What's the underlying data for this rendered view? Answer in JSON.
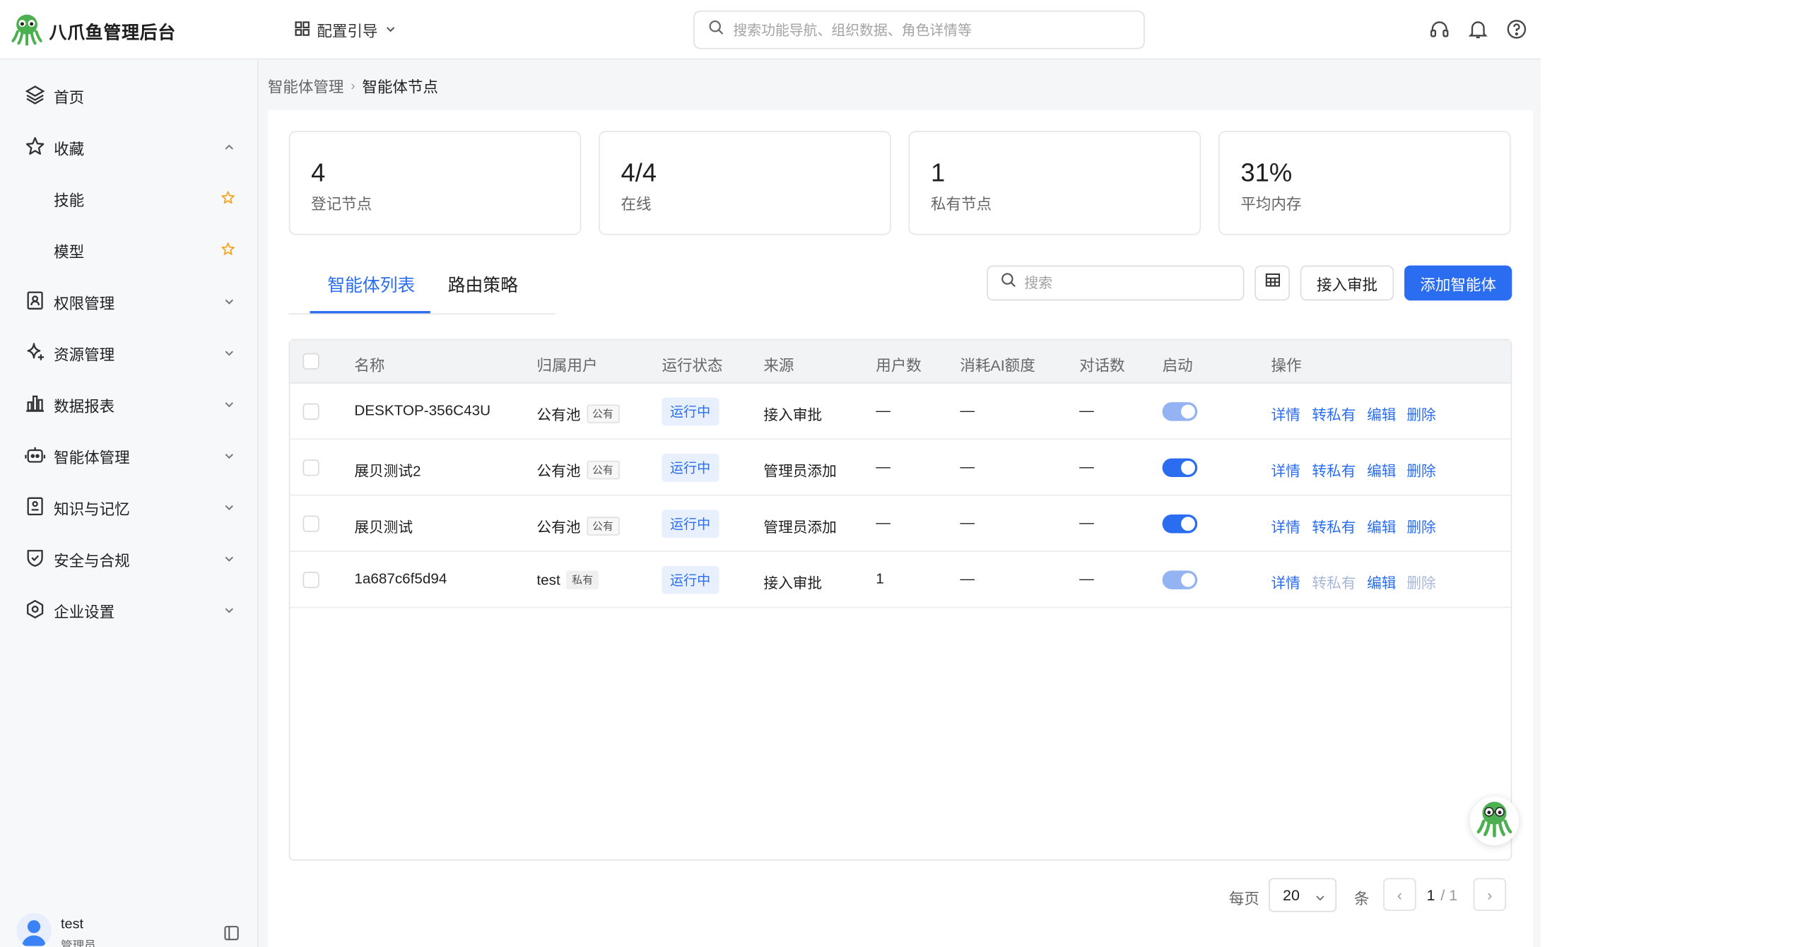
{
  "app": {
    "title": "八爪鱼管理后台"
  },
  "header": {
    "config_guide": "配置引导",
    "search_placeholder": "搜索功能导航、组织数据、角色详情等"
  },
  "sidebar": {
    "items": [
      {
        "label": "首页",
        "icon": "layers-icon"
      },
      {
        "label": "收藏",
        "icon": "star-outline-icon",
        "expanded": true
      },
      {
        "label": "技能",
        "icon": "star-filled-icon",
        "child": true
      },
      {
        "label": "模型",
        "icon": "star-filled-icon",
        "child": true
      },
      {
        "label": "权限管理",
        "icon": "id-card-icon"
      },
      {
        "label": "资源管理",
        "icon": "sparkle-icon"
      },
      {
        "label": "数据报表",
        "icon": "bar-chart-icon"
      },
      {
        "label": "智能体管理",
        "icon": "robot-icon"
      },
      {
        "label": "知识与记忆",
        "icon": "book-icon"
      },
      {
        "label": "安全与合规",
        "icon": "shield-check-icon"
      },
      {
        "label": "企业设置",
        "icon": "settings-hex-icon"
      }
    ],
    "user": {
      "name": "test",
      "role": "管理员"
    }
  },
  "breadcrumb": {
    "parent": "智能体管理",
    "current": "智能体节点"
  },
  "stats": [
    {
      "value": "4",
      "label": "登记节点"
    },
    {
      "value": "4/4",
      "label": "在线"
    },
    {
      "value": "1",
      "label": "私有节点"
    },
    {
      "value": "31%",
      "label": "平均内存"
    }
  ],
  "tabs": [
    {
      "label": "智能体列表",
      "active": true
    },
    {
      "label": "路由策略",
      "active": false
    }
  ],
  "toolbar": {
    "search_placeholder": "搜索",
    "approve_label": "接入审批",
    "add_label": "添加智能体"
  },
  "table": {
    "columns": [
      "名称",
      "归属用户",
      "运行状态",
      "来源",
      "用户数",
      "消耗AI额度",
      "对话数",
      "启动",
      "操作"
    ],
    "rows": [
      {
        "name": "DESKTOP-356C43U",
        "owner": "公有池",
        "owner_tag": "公有",
        "status": "运行中",
        "source": "接入审批",
        "users": "—",
        "quota": "—",
        "chats": "—",
        "enabled": true,
        "toggle_dim": true,
        "actions": [
          "详情",
          "转私有",
          "编辑",
          "删除"
        ],
        "actions_disabled": [
          false,
          false,
          false,
          false
        ]
      },
      {
        "name": "展贝测试2",
        "owner": "公有池",
        "owner_tag": "公有",
        "status": "运行中",
        "source": "管理员添加",
        "users": "—",
        "quota": "—",
        "chats": "—",
        "enabled": true,
        "toggle_dim": false,
        "actions": [
          "详情",
          "转私有",
          "编辑",
          "删除"
        ],
        "actions_disabled": [
          false,
          false,
          false,
          false
        ]
      },
      {
        "name": "展贝测试",
        "owner": "公有池",
        "owner_tag": "公有",
        "status": "运行中",
        "source": "管理员添加",
        "users": "—",
        "quota": "—",
        "chats": "—",
        "enabled": true,
        "toggle_dim": false,
        "actions": [
          "详情",
          "转私有",
          "编辑",
          "删除"
        ],
        "actions_disabled": [
          false,
          false,
          false,
          false
        ]
      },
      {
        "name": "1a687c6f5d94",
        "owner": "test",
        "owner_tag": "私有",
        "status": "运行中",
        "source": "接入审批",
        "users": "1",
        "quota": "—",
        "chats": "—",
        "enabled": true,
        "toggle_dim": true,
        "actions": [
          "详情",
          "转私有",
          "编辑",
          "删除"
        ],
        "actions_disabled": [
          false,
          true,
          false,
          true
        ]
      }
    ]
  },
  "pagination": {
    "per_page_label": "每页",
    "per_page": "20",
    "unit": "条",
    "prev": "‹",
    "next": "›",
    "current": "1",
    "total": "/ 1"
  },
  "colors": {
    "primary": "#2b6df0",
    "status_bg": "#e8f0fe",
    "brand_green": "#4caf50"
  }
}
